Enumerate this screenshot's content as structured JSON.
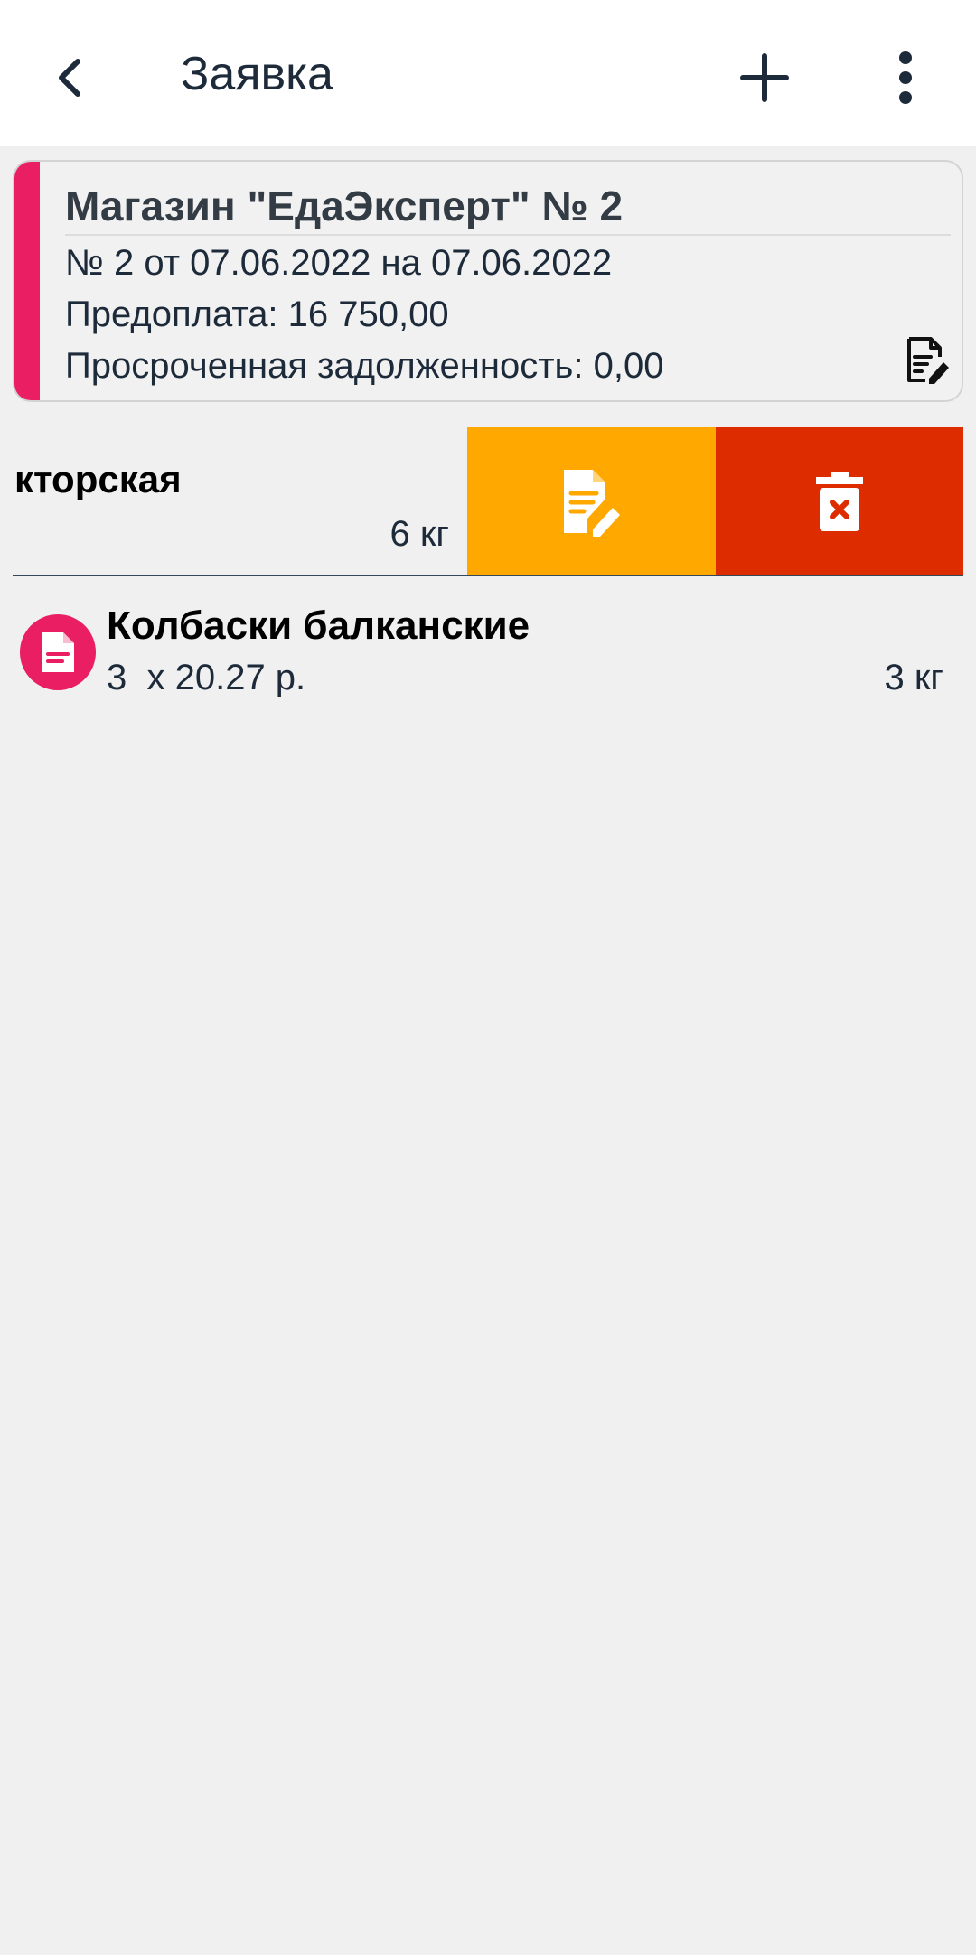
{
  "header": {
    "title": "Заявка"
  },
  "order": {
    "store": "Магазин \"ЕдаЭксперт\" № 2",
    "number_dates": "№ 2 от 07.06.2022 на 07.06.2022",
    "prepayment": "Предоплата: 16 750,00",
    "overdue": "Просроченная задолженность: 0,00"
  },
  "items": [
    {
      "name": "кторская",
      "qty": "6 кг",
      "swiped": true
    },
    {
      "name": "Колбаски балканские",
      "price": "3  x 20.27 р.",
      "qty": "3 кг"
    }
  ],
  "colors": {
    "accent_pink": "#e91e63",
    "edit_action": "#ffa800",
    "delete_action": "#dd2c00",
    "text_dark": "#1d2a3a",
    "background": "#f0f0f0"
  },
  "icons": {
    "back": "back-arrow-icon",
    "add": "plus-icon",
    "more": "more-vert-icon",
    "header_edit": "edit-document-icon",
    "swipe_edit": "edit-note-icon",
    "swipe_delete": "delete-icon",
    "item_badge": "document-icon"
  }
}
